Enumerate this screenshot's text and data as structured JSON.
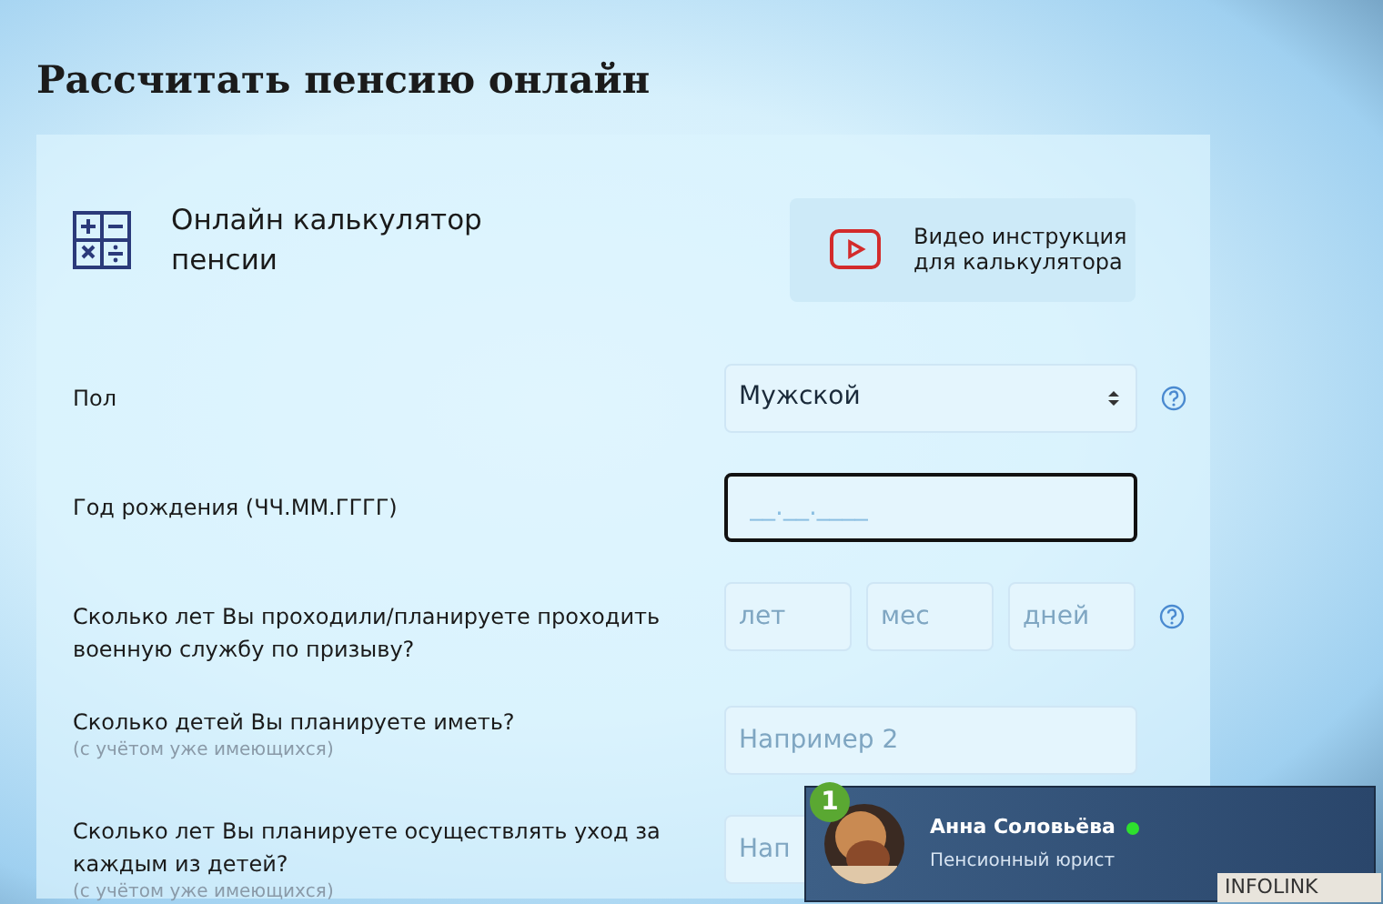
{
  "title": "Рассчитать пенсию онлайн",
  "calculator": {
    "title": "Онлайн калькулятор пенсии",
    "video_button": "Видео инструкция для калькулятора"
  },
  "fields": [
    {
      "kind": "select",
      "label": "Пол",
      "value": "Мужской",
      "help": true
    },
    {
      "kind": "masked",
      "label": "Год рождения (ЧЧ.ММ.ГГГГ)",
      "value": "__.__.____",
      "focused": true,
      "help": false
    },
    {
      "kind": "triple",
      "label": "Сколько лет Вы проходили/планируете проходить военную службу по призыву?",
      "placeholders": [
        "лет",
        "мес",
        "дней"
      ],
      "help": true
    },
    {
      "kind": "text",
      "label": "Сколько детей Вы планируете иметь?",
      "note": "(с учётом уже имеющихся)",
      "placeholder": "Например 2",
      "help": false
    },
    {
      "kind": "text",
      "label": "Сколько лет Вы планируете осуществлять уход за каждым из детей?",
      "note": "(с учётом уже имеющихся)",
      "placeholder": "Нап"
    }
  ],
  "chat": {
    "badge": "1",
    "name": "Анна Соловьёва",
    "online": true,
    "role": "Пенсионный юрист",
    "tag": "INFOLINK"
  }
}
